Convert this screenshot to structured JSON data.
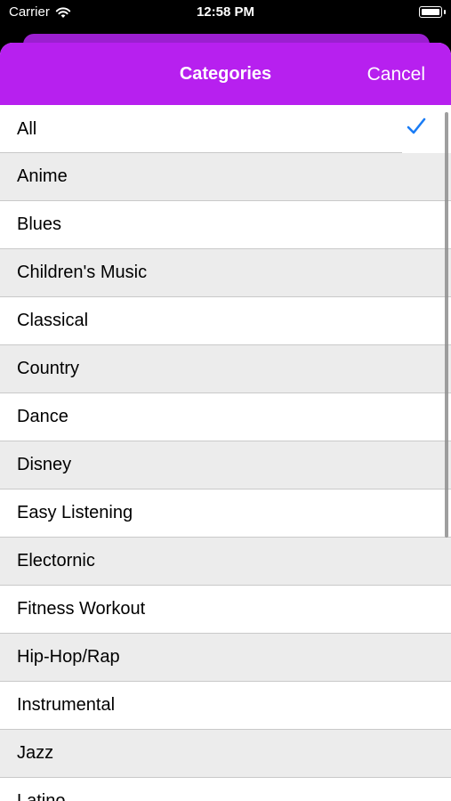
{
  "status_bar": {
    "carrier": "Carrier",
    "time": "12:58 PM"
  },
  "header": {
    "title": "Categories",
    "cancel_label": "Cancel"
  },
  "colors": {
    "nav_background": "#b720ef",
    "checkmark": "#1a7cf5",
    "alt_row": "#ececec"
  },
  "list": {
    "selected": "All",
    "items": [
      {
        "label": "All"
      },
      {
        "label": "Anime"
      },
      {
        "label": "Blues"
      },
      {
        "label": "Children's Music"
      },
      {
        "label": "Classical"
      },
      {
        "label": "Country"
      },
      {
        "label": "Dance"
      },
      {
        "label": "Disney"
      },
      {
        "label": "Easy Listening"
      },
      {
        "label": "Electornic"
      },
      {
        "label": "Fitness Workout"
      },
      {
        "label": "Hip-Hop/Rap"
      },
      {
        "label": "Instrumental"
      },
      {
        "label": "Jazz"
      },
      {
        "label": "Latino"
      }
    ]
  }
}
